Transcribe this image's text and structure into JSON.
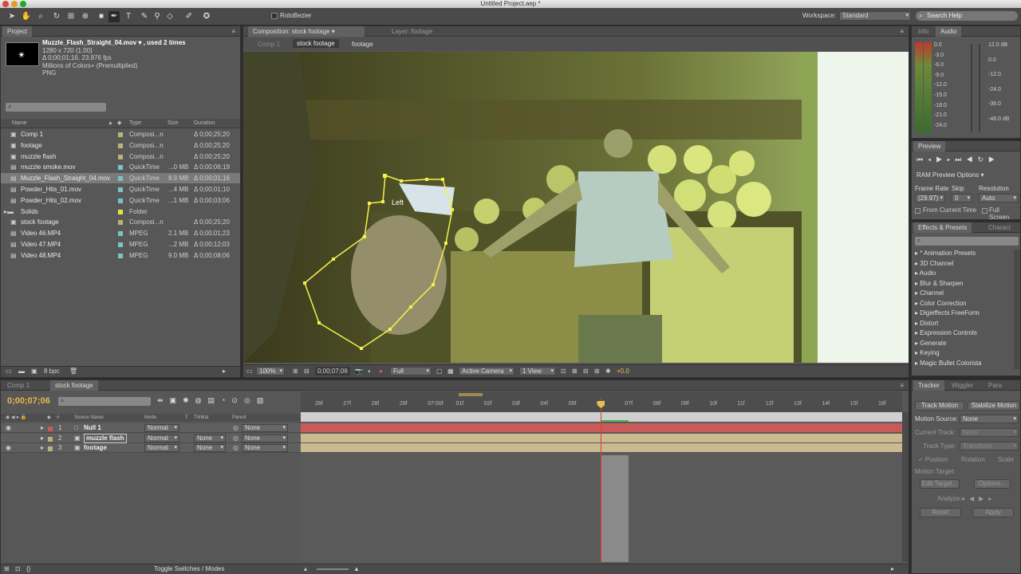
{
  "window": {
    "title": "Untitled Project.aep *"
  },
  "toolbar": {
    "rotobezier_label": "RotoBezier",
    "workspace_label": "Workspace:",
    "workspace_value": "Standard",
    "search_help_placeholder": "Search Help"
  },
  "project": {
    "tab": "Project",
    "info_name": "Muzzle_Flash_Straight_04.mov ▾ , used 2 times",
    "info_dims": "1280 x 720 (1.00)",
    "info_duration": "Δ 0;00;01;16, 23.976 fps",
    "info_colors": "Millions of Colors+ (Premultiplied)",
    "info_format": "PNG",
    "columns": {
      "name": "Name",
      "type": "Type",
      "size": "Size",
      "duration": "Duration"
    },
    "rows": [
      {
        "name": "Comp 1",
        "type": "Composi...n",
        "size": "",
        "duration": "Δ 0;00;25;20",
        "color": "#b9b37a",
        "icon": "comp"
      },
      {
        "name": "footage",
        "type": "Composi...n",
        "size": "",
        "duration": "Δ 0;00;25;20",
        "color": "#b9b37a",
        "icon": "comp"
      },
      {
        "name": "muzzle flash",
        "type": "Composi...n",
        "size": "",
        "duration": "Δ 0;00;25;20",
        "color": "#b9b37a",
        "icon": "comp"
      },
      {
        "name": "muzzle smoke.mov",
        "type": "QuickTime",
        "size": "...0 MB",
        "duration": "Δ 0;00;06;19",
        "color": "#7cc4c4",
        "icon": "file"
      },
      {
        "name": "Muzzle_Flash_Straight_04.mov",
        "type": "QuickTime",
        "size": "8.9 MB",
        "duration": "Δ 0;00;01;16",
        "color": "#7cc4c4",
        "icon": "file",
        "selected": true
      },
      {
        "name": "Powder_Hits_01.mov",
        "type": "QuickTime",
        "size": "...4 MB",
        "duration": "Δ 0;00;01;10",
        "color": "#7cc4c4",
        "icon": "file"
      },
      {
        "name": "Powder_Hits_02.mov",
        "type": "QuickTime",
        "size": "...1 MB",
        "duration": "Δ 0;00;03;06",
        "color": "#7cc4c4",
        "icon": "file"
      },
      {
        "name": "Solids",
        "type": "Folder",
        "size": "",
        "duration": "",
        "color": "#e8e440",
        "icon": "folder"
      },
      {
        "name": "stock footage",
        "type": "Composi...n",
        "size": "",
        "duration": "Δ 0;00;25;20",
        "color": "#b9b37a",
        "icon": "comp"
      },
      {
        "name": "Video 46.MP4",
        "type": "MPEG",
        "size": "2.1 MB",
        "duration": "Δ 0;00;01;23",
        "color": "#7cc4c4",
        "icon": "file"
      },
      {
        "name": "Video 47.MP4",
        "type": "MPEG",
        "size": "...2 MB",
        "duration": "Δ 0;00;12;03",
        "color": "#7cc4c4",
        "icon": "file"
      },
      {
        "name": "Video 48.MP4",
        "type": "MPEG",
        "size": "9.0 MB",
        "duration": "Δ 0;00;08;06",
        "color": "#7cc4c4",
        "icon": "file"
      }
    ],
    "bpc": "8 bpc"
  },
  "comp": {
    "tab": "Composition: stock footage",
    "layer_tab": "Layer: footage",
    "crumbs": [
      "Comp 1",
      "stock footage",
      "footage"
    ],
    "mask_label": "Left",
    "zoom": "100%",
    "timecode": "0;00;07;06",
    "resolution": "Full",
    "camera": "Active Camera",
    "view": "1 View",
    "exposure": "+0.0"
  },
  "info_panel": {
    "tabs": [
      "Info",
      "Audio"
    ],
    "left_scale": [
      "0.0",
      "-3.0",
      "-6.0",
      "-9.0",
      "-12.0",
      "-15.0",
      "-18.0",
      "-21.0",
      "-24.0"
    ],
    "right_scale": [
      "12.0 dB",
      "0.0",
      "-12.0",
      "-24.0",
      "-36.0",
      "-48.0 dB"
    ]
  },
  "preview": {
    "tab": "Preview",
    "ram_preview": "RAM Preview Options",
    "frame_rate_label": "Frame Rate",
    "skip_label": "Skip",
    "resolution_label": "Resolution",
    "frame_rate": "(29.97)",
    "skip": "0",
    "resolution": "Auto",
    "from_current": "From Current Time",
    "full_screen": "Full Screen"
  },
  "effects": {
    "tabs": [
      "Effects & Presets",
      "Charact"
    ],
    "items": [
      "* Animation Presets",
      "3D Channel",
      "Audio",
      "Blur & Sharpen",
      "Channel",
      "Color Correction",
      "Digieffects FreeForm",
      "Distort",
      "Expression Controls",
      "Generate",
      "Keying",
      "Magic Bullet Colorista"
    ]
  },
  "tracker": {
    "tabs": [
      "Tracker",
      "Wiggler",
      "Para"
    ],
    "track_motion": "Track Motion",
    "stabilize_motion": "Stabilize Motion",
    "motion_source_label": "Motion Source:",
    "motion_source": "None",
    "current_track_label": "Current Track:",
    "current_track": "None",
    "track_type_label": "Track Type:",
    "track_type": "Transform",
    "position": "✓ Position",
    "rotation": "Rotation",
    "scale": "Scale",
    "motion_target": "Motion Target:",
    "edit_target": "Edit Target...",
    "options": "Options...",
    "analyze": "Analyze:",
    "reset": "Reset",
    "apply": "Apply"
  },
  "timeline": {
    "tabs": [
      "Comp 1",
      "stock footage"
    ],
    "timecode": "0;00;07;06",
    "columns": {
      "source_name": "Source Name",
      "mode": "Mode",
      "t": "T",
      "trkmat": "TrkMat",
      "parent": "Parent"
    },
    "layers": [
      {
        "num": "1",
        "name": "Null 1",
        "mode": "Normal",
        "trkmat": "",
        "parent": "None",
        "label_color": "#c85a5a",
        "bar_color": "#c85a5a"
      },
      {
        "num": "2",
        "name": "muzzle flash",
        "mode": "Normal",
        "trkmat": "None",
        "parent": "None",
        "label_color": "#b9b37a",
        "bar_color": "#cbb98f"
      },
      {
        "num": "3",
        "name": "footage",
        "mode": "Normal",
        "trkmat": "None",
        "parent": "None",
        "label_color": "#b9b37a",
        "bar_color": "#cbb98f"
      }
    ],
    "ruler": [
      "26f",
      "27f",
      "28f",
      "29f",
      "07:00f",
      "01f",
      "02f",
      "03f",
      "04f",
      "05f",
      "06f",
      "07f",
      "08f",
      "09f",
      "10f",
      "11f",
      "12f",
      "13f",
      "14f",
      "15f",
      "16f"
    ],
    "toggle_label": "Toggle Switches / Modes"
  }
}
